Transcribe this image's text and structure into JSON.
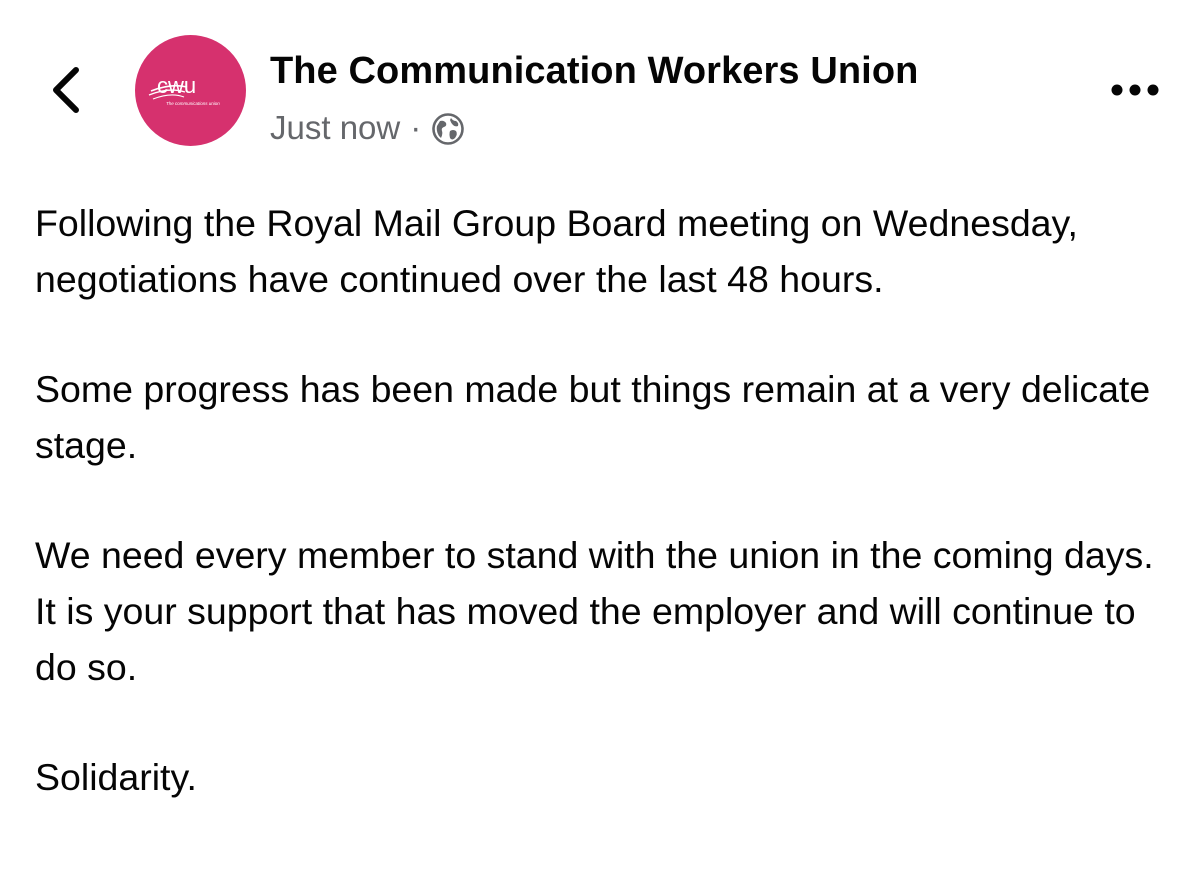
{
  "header": {
    "back_icon": "chevron-left-icon",
    "avatar": {
      "logo_text": "cwu",
      "tagline": "The communications union",
      "background": "#d6316e"
    },
    "page_name": "The Communication Workers Union",
    "timestamp": "Just now",
    "separator": "·",
    "privacy_icon": "globe-icon",
    "more_icon": "more-horizontal-icon"
  },
  "post": {
    "paragraphs": [
      "Following the Royal Mail Group Board meeting on Wednesday, negotiations have continued over the last 48 hours.",
      "Some progress has been made but things remain at a very delicate stage.",
      "We need every member to stand with the union in the coming days. It is your support that has moved the employer and will continue to do so.",
      "Solidarity."
    ]
  },
  "colors": {
    "text": "#050505",
    "secondary_text": "#65676b",
    "brand": "#d6316e"
  }
}
